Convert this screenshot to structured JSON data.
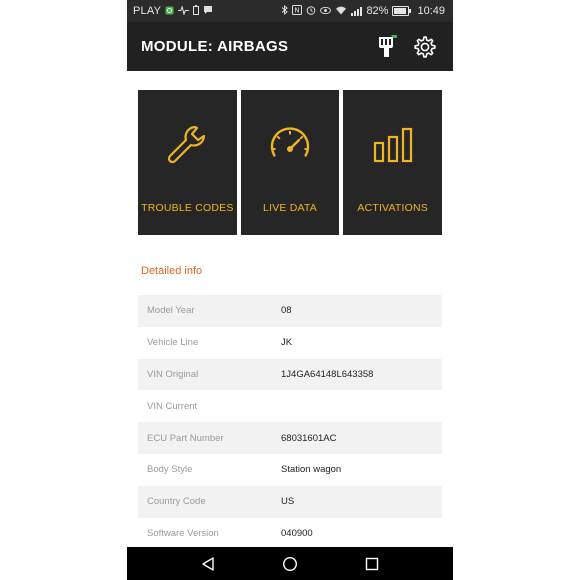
{
  "status_bar": {
    "carrier": "PLAY",
    "battery_percent": "82%",
    "time": "10:49",
    "icons": [
      "whatsapp-icon",
      "pulse-icon",
      "battery-saver-icon",
      "chat-icon",
      "bluetooth-icon",
      "nfc-icon",
      "alarm-icon",
      "eye-icon",
      "wifi-icon",
      "signal-icon",
      "battery-icon"
    ]
  },
  "app_bar": {
    "title": "MODULE: AIRBAGS",
    "actions": [
      "obd-adapter-icon",
      "gear-icon"
    ]
  },
  "tiles": [
    {
      "label": "TROUBLE CODES",
      "icon": "wrench-icon"
    },
    {
      "label": "LIVE DATA",
      "icon": "speedometer-icon"
    },
    {
      "label": "ACTIVATIONS",
      "icon": "bar-chart-icon"
    }
  ],
  "detailed_info": {
    "title": "Detailed info",
    "rows": [
      {
        "key": "Model Year",
        "value": "08"
      },
      {
        "key": "Vehicle Line",
        "value": "JK"
      },
      {
        "key": "VIN Original",
        "value": "1J4GA64148L643358"
      },
      {
        "key": "VIN Current",
        "value": ""
      },
      {
        "key": "ECU Part Number",
        "value": "68031601AC"
      },
      {
        "key": "Body Style",
        "value": "Station wagon"
      },
      {
        "key": "Country Code",
        "value": "US"
      },
      {
        "key": "Software Version",
        "value": "040900"
      }
    ]
  },
  "colors": {
    "accent": "#f0b323",
    "section_title": "#e0662a",
    "adapter_led": "#4caf50"
  },
  "nav_bar": [
    "back-icon",
    "home-icon",
    "recents-icon"
  ]
}
